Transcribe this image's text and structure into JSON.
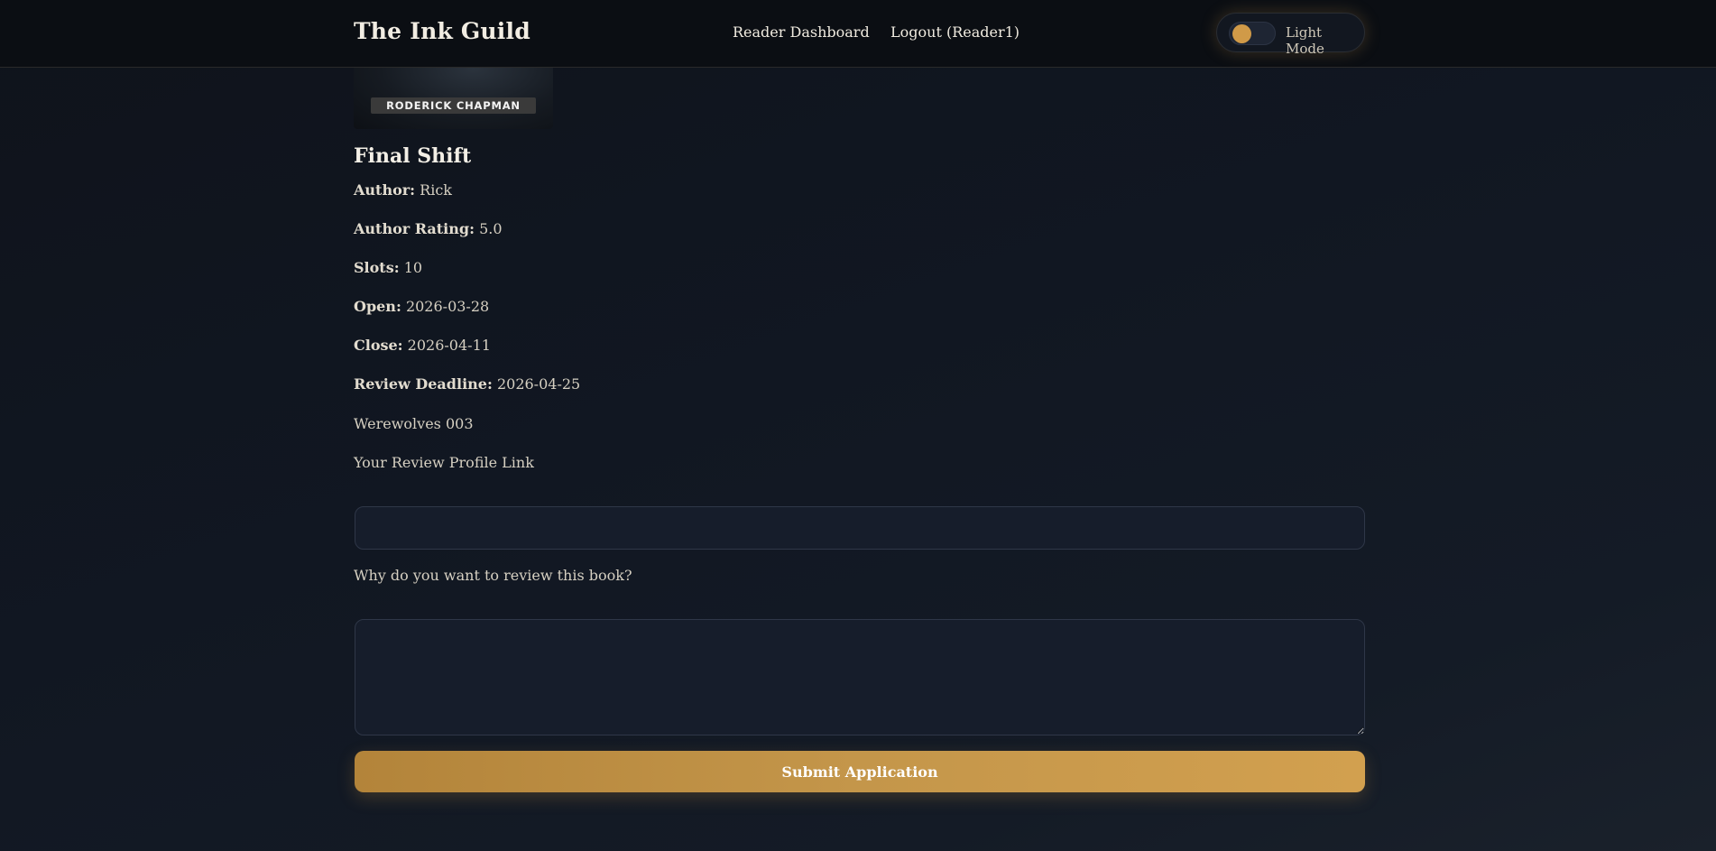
{
  "header": {
    "brand": "The Ink Guild",
    "nav": {
      "dashboard": "Reader Dashboard",
      "logout": "Logout (Reader1)"
    },
    "theme_toggle_label": "Light Mode"
  },
  "book": {
    "cover_author": "RODERICK CHAPMAN",
    "title": "Final Shift",
    "author_label": "Author:",
    "author": "Rick",
    "author_rating_label": "Author Rating:",
    "author_rating": "5.0",
    "slots_label": "Slots:",
    "slots": "10",
    "open_label": "Open:",
    "open": "2026-03-28",
    "close_label": "Close:",
    "close": "2026-04-11",
    "review_deadline_label": "Review Deadline:",
    "review_deadline": "2026-04-25",
    "series": "Werewolves 003"
  },
  "form": {
    "profile_link_label": "Your Review Profile Link",
    "profile_link_value": "",
    "why_label": "Why do you want to review this book?",
    "why_value": "",
    "submit_label": "Submit Application"
  },
  "colors": {
    "accent": "#d09a48",
    "background": "#111722"
  }
}
